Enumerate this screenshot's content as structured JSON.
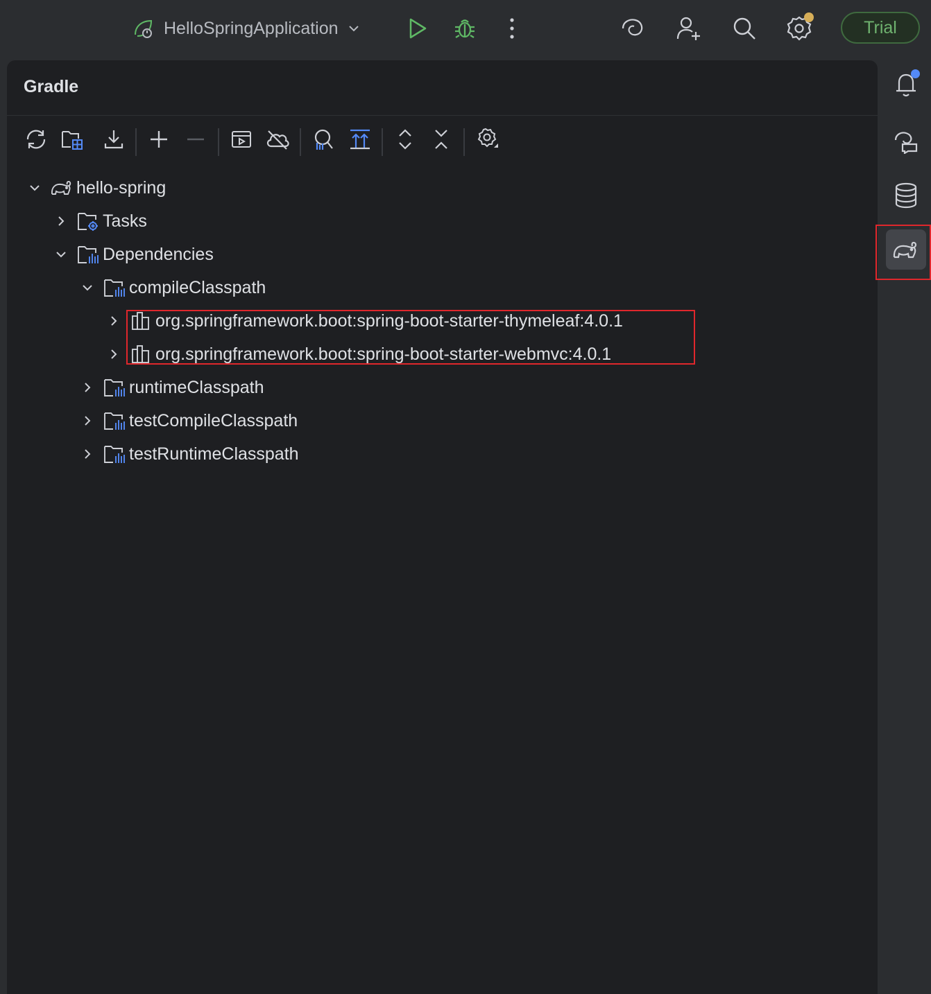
{
  "topbar": {
    "run_config_label": "HelloSpringApplication",
    "trial_label": "Trial"
  },
  "panel": {
    "title": "Gradle"
  },
  "tree": {
    "root": "hello-spring",
    "tasks": "Tasks",
    "dependencies": "Dependencies",
    "compile_classpath": "compileClasspath",
    "dep1": "org.springframework.boot:spring-boot-starter-thymeleaf:4.0.1",
    "dep2": "org.springframework.boot:spring-boot-starter-webmvc:4.0.1",
    "runtime_classpath": "runtimeClasspath",
    "test_compile_classpath": "testCompileClasspath",
    "test_runtime_classpath": "testRuntimeClasspath"
  },
  "colors": {
    "panel_bg": "#1e1f22",
    "chrome_bg": "#2b2d30",
    "text": "#dfe1e5",
    "icon": "#ced0d6",
    "accent_blue": "#548af7",
    "run_green": "#5fb865",
    "highlight_red": "#e0272c",
    "notification_dot": "#548af7",
    "settings_dot": "#d6ae58"
  }
}
